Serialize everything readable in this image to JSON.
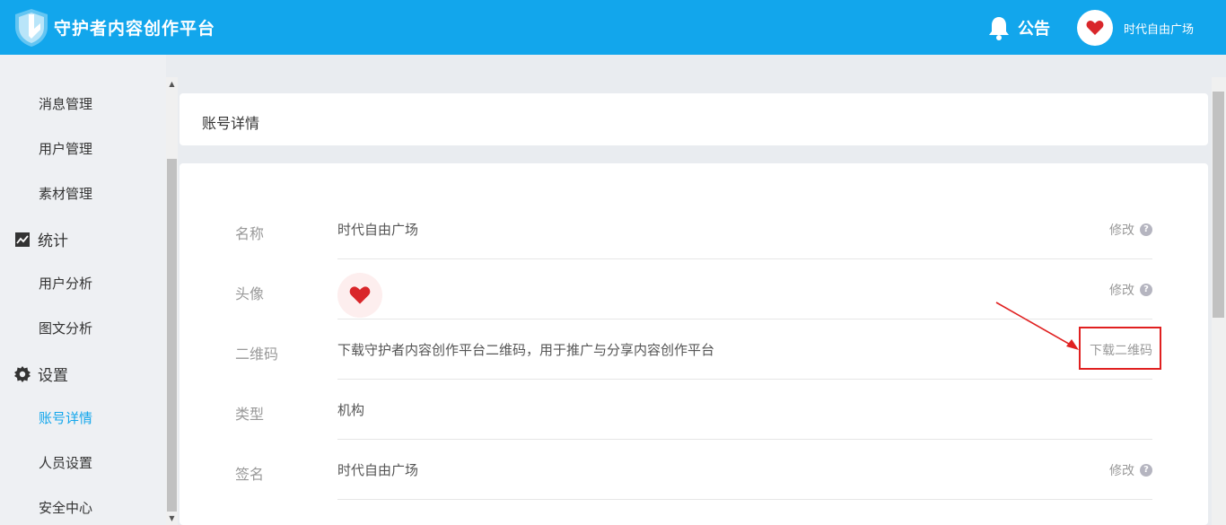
{
  "header": {
    "app_title": "守护者内容创作平台",
    "notice_label": "公告",
    "user_name": "时代自由广场",
    "brand_color": "#12a6ec"
  },
  "sidebar": {
    "items": [
      {
        "label": "消息管理"
      },
      {
        "label": "用户管理"
      },
      {
        "label": "素材管理"
      },
      {
        "label": "统计",
        "section": true,
        "icon": "chart-icon"
      },
      {
        "label": "用户分析"
      },
      {
        "label": "图文分析"
      },
      {
        "label": "设置",
        "section": true,
        "icon": "gear-icon"
      },
      {
        "label": "账号详情",
        "active": true
      },
      {
        "label": "人员设置"
      },
      {
        "label": "安全中心"
      }
    ]
  },
  "page": {
    "title": "账号详情"
  },
  "details": {
    "rows": [
      {
        "label": "名称",
        "value": "时代自由广场",
        "action": "修改"
      },
      {
        "label": "头像",
        "value": "",
        "action": "修改"
      },
      {
        "label": "二维码",
        "value": "下载守护者内容创作平台二维码，用于推广与分享内容创作平台",
        "action": "下载二维码"
      },
      {
        "label": "类型",
        "value": "机构",
        "action": ""
      },
      {
        "label": "签名",
        "value": "时代自由广场",
        "action": "修改"
      }
    ]
  },
  "highlight_color": "#e02020"
}
